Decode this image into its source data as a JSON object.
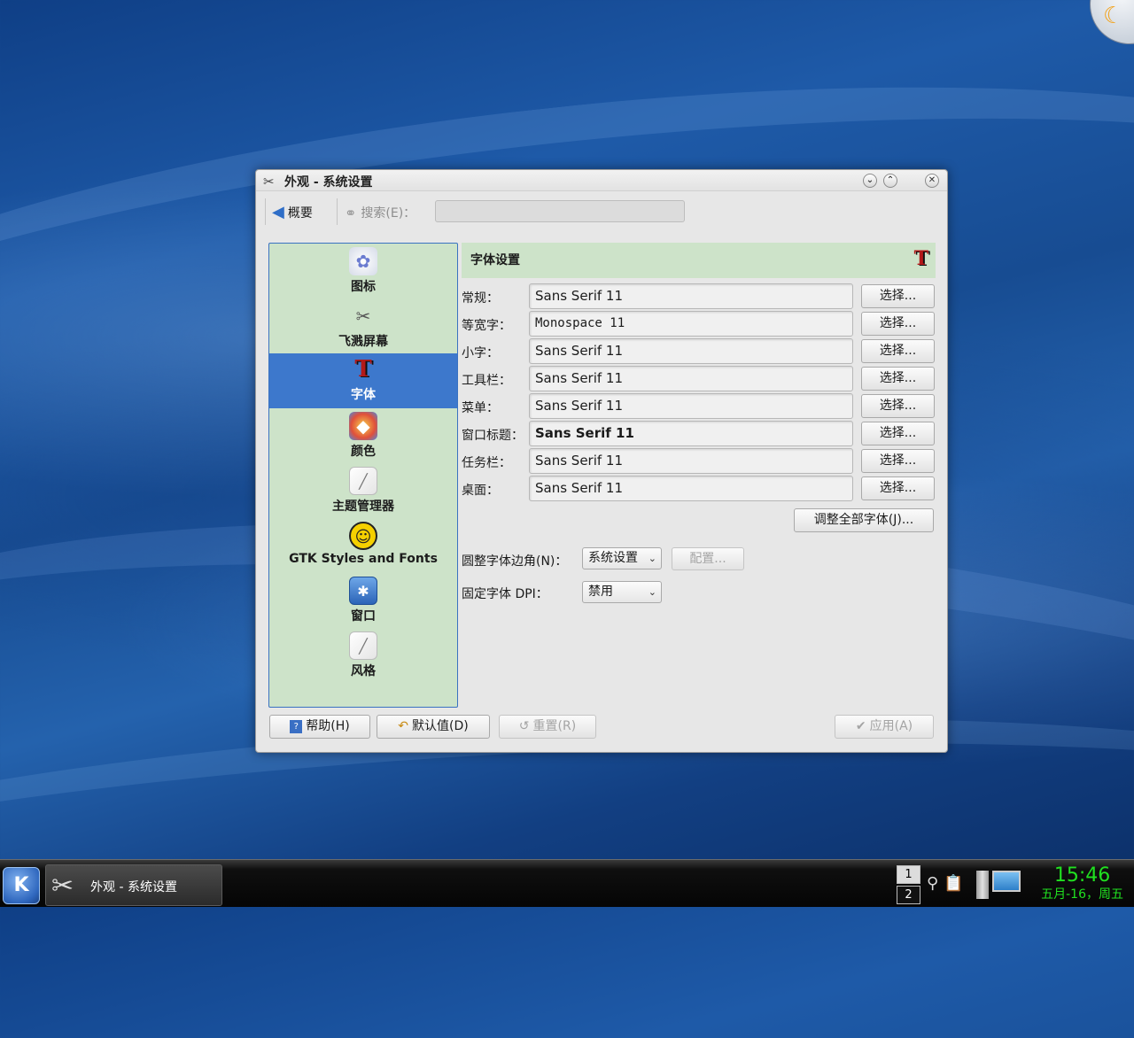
{
  "window": {
    "title": "外观 - 系统设置",
    "toolbar": {
      "overview_label": "概要",
      "search_label": "搜索(E)：",
      "search_value": ""
    },
    "sidebar": {
      "items": [
        {
          "label": "图标",
          "icon": "icons-icon"
        },
        {
          "label": "飞溅屏幕",
          "icon": "splash-screen-icon"
        },
        {
          "label": "字体",
          "icon": "fonts-icon"
        },
        {
          "label": "颜色",
          "icon": "colors-icon"
        },
        {
          "label": "主题管理器",
          "icon": "theme-manager-icon"
        },
        {
          "label": "GTK Styles and Fonts",
          "icon": "gtk-icon"
        },
        {
          "label": "窗口",
          "icon": "windows-icon"
        },
        {
          "label": "风格",
          "icon": "style-icon"
        }
      ],
      "selected": "字体"
    },
    "panel": {
      "title": "字体设置",
      "font_rows": [
        {
          "label": "常规：",
          "value": "Sans Serif 11",
          "button": "选择..."
        },
        {
          "label": "等宽字：",
          "value": "Monospace 11",
          "button": "选择..."
        },
        {
          "label": "小字：",
          "value": "Sans Serif 11",
          "button": "选择..."
        },
        {
          "label": "工具栏：",
          "value": "Sans Serif 11",
          "button": "选择..."
        },
        {
          "label": "菜单：",
          "value": "Sans Serif 11",
          "button": "选择..."
        },
        {
          "label": "窗口标题：",
          "value": "Sans Serif 11",
          "button": "选择..."
        },
        {
          "label": "任务栏：",
          "value": "Sans Serif 11",
          "button": "选择..."
        },
        {
          "label": "桌面：",
          "value": "Sans Serif 11",
          "button": "选择..."
        }
      ],
      "adjust_all_button": "调整全部字体(J)...",
      "antialias_label": "圆整字体边角(N)：",
      "antialias_value": "系统设置",
      "configure_button": "配置...",
      "dpi_label": "固定字体 DPI：",
      "dpi_value": "禁用"
    },
    "buttons": {
      "help": "帮助(H)",
      "defaults": "默认值(D)",
      "reset": "重置(R)",
      "apply": "应用(A)"
    }
  },
  "taskbar": {
    "task_label": "外观 - 系统设置",
    "pager": [
      "1",
      "2"
    ],
    "clock_time": "15:46",
    "clock_date": "五月-16，周五"
  }
}
